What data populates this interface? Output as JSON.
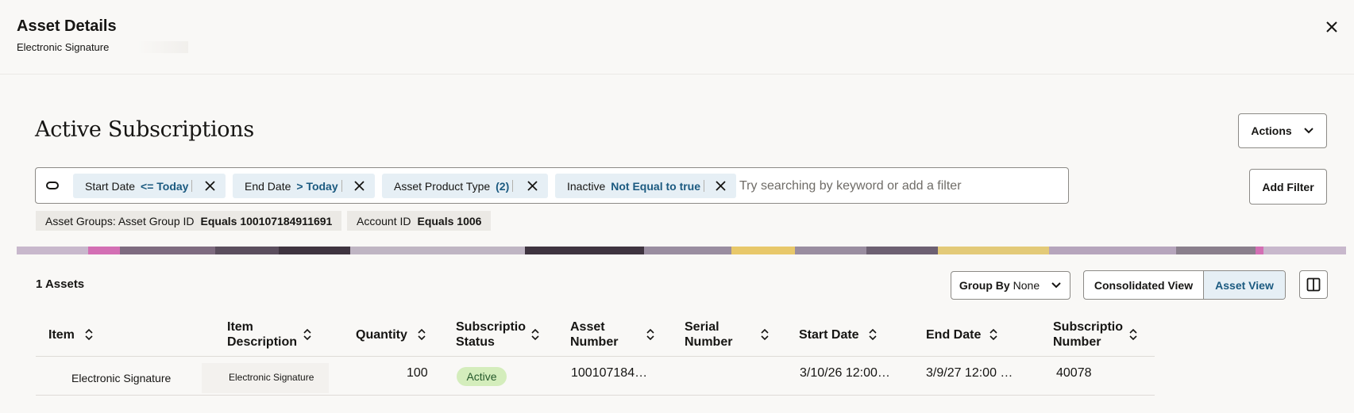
{
  "header": {
    "title": "Asset Details",
    "subtitle": "Electronic Signature"
  },
  "page": {
    "heading": "Active Subscriptions",
    "actions_label": "Actions",
    "add_filter_label": "Add Filter"
  },
  "filters": {
    "chips": [
      {
        "label": "Start Date",
        "value": "<= Today"
      },
      {
        "label": "End Date",
        "value": "> Today"
      },
      {
        "label": "Asset Product Type",
        "value": "(2)"
      },
      {
        "label": "Inactive",
        "value": "Not Equal to true"
      }
    ],
    "search_placeholder": "Try searching by keyword or add a filter",
    "tags": [
      {
        "label": "Asset Groups: Asset Group ID",
        "value": "Equals 100107184911691"
      },
      {
        "label": "Account ID",
        "value": "Equals 1006"
      }
    ]
  },
  "toolbar": {
    "count": "1 Assets",
    "group_by_label": "Group By",
    "group_by_value": "None",
    "consolidated_view": "Consolidated View",
    "asset_view": "Asset View"
  },
  "table": {
    "columns": [
      {
        "line1": "Item",
        "line2": ""
      },
      {
        "line1": "Item",
        "line2": "Description"
      },
      {
        "line1": "Quantity",
        "line2": ""
      },
      {
        "line1": "Subscriptio",
        "line2": "Status"
      },
      {
        "line1": "Asset",
        "line2": "Number"
      },
      {
        "line1": "Serial",
        "line2": "Number"
      },
      {
        "line1": "Start Date",
        "line2": ""
      },
      {
        "line1": "End Date",
        "line2": ""
      },
      {
        "line1": "Subscriptio",
        "line2": "Number"
      }
    ],
    "rows": [
      {
        "item": "Electronic Signature",
        "item_description": "Electronic Signature",
        "quantity": "100",
        "status": "Active",
        "asset_number": "100107184…",
        "serial_number": "",
        "start_date": "3/10/26 12:00…",
        "end_date": "3/9/27 12:00 …",
        "subscription_number": "40078"
      }
    ]
  },
  "colors": {
    "chip_bg": "#e6eff5",
    "chip_value": "#1b5a80",
    "active_badge_bg": "#d4edbc",
    "active_badge_text": "#25592a",
    "page_bg": "#f9f8f6"
  },
  "icons": [
    "close-icon",
    "chevron-down-icon",
    "filter-toggle-icon",
    "sort-icon",
    "panel-columns-icon"
  ]
}
